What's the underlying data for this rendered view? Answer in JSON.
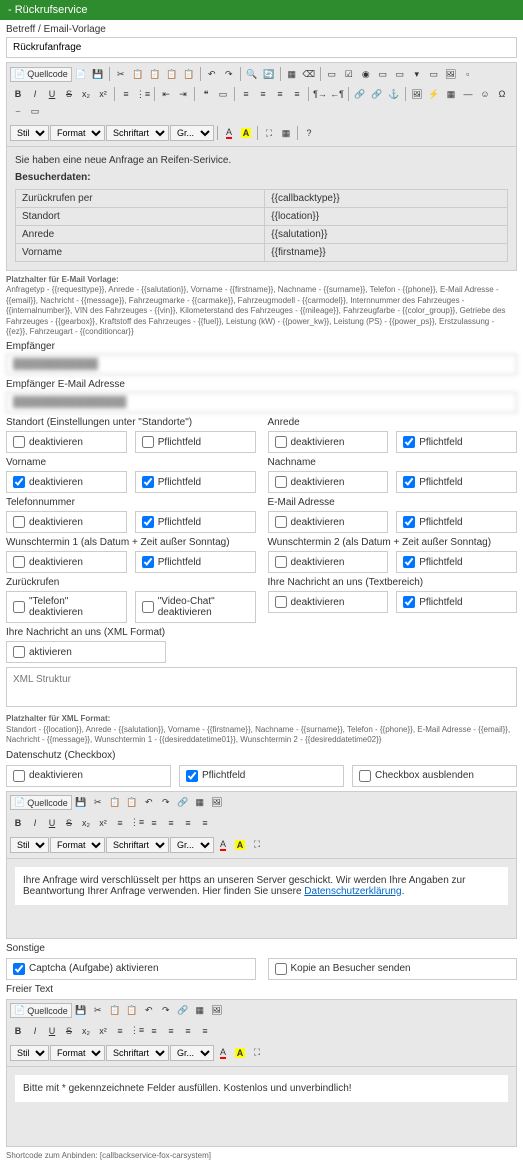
{
  "header": {
    "title": "- Rückrufservice"
  },
  "subject": {
    "label": "Betreff / Email-Vorlage",
    "value": "Rückrufanfrage"
  },
  "toolbar": {
    "quellcode": "Quellcode",
    "stil": "Stil",
    "format": "Format",
    "schriftart": "Schriftart",
    "groesse": "Gr..."
  },
  "editor1": {
    "intro": "Sie haben eine neue Anfrage an Reifen-Serivice.",
    "besucherdaten": "Besucherdaten:",
    "rows": [
      {
        "k": "Zurückrufen per",
        "v": "{{callbacktype}}"
      },
      {
        "k": "Standort",
        "v": "{{location}}"
      },
      {
        "k": "Anrede",
        "v": "{{salutation}}"
      },
      {
        "k": "Vorname",
        "v": "{{firstname}}"
      }
    ]
  },
  "placeholders_email": {
    "title": "Platzhalter für E-Mail Vorlage:",
    "text": "Anfragetyp - {{requesttype}}, Anrede - {{salutation}}, Vorname - {{firstname}}, Nachname - {{surname}}, Telefon - {{phone}}, E-Mail Adresse - {{email}}, Nachricht - {{message}}, Fahrzeugmarke - {{carmake}}, Fahrzeugmodell - {{carmodel}}, Internnummer des Fahrzeuges - {{internalnumber}}, VIN des Fahrzeuges - {{vin}}, Kilometerstand des Fahrzeuges - {{mileage}}, Fahrzeugfarbe - {{color_group}}, Getriebe des Fahrzeuges - {{gearbox}}, Kraftstoff des Fahrzeuges - {{fuel}}, Leistung (kW) - {{power_kw}}, Leistung (PS) - {{power_ps}}, Erstzulassung - {{ez}}, Fahrzeugart - {{conditioncar}}"
  },
  "empfaenger": {
    "label": "Empfänger",
    "value": "████████████"
  },
  "empfaenger_email": {
    "label": "Empfänger E-Mail Adresse",
    "value": "████████████████"
  },
  "labels": {
    "deaktivieren": "deaktivieren",
    "pflichtfeld": "Pflichtfeld",
    "aktivieren": "aktivieren",
    "telefon_deakt": "\"Telefon\" deaktivieren",
    "video_deakt": "\"Video-Chat\" deaktivieren",
    "checkbox_ausblenden": "Checkbox ausblenden",
    "captcha": "Captcha (Aufgabe) aktivieren",
    "kopie": "Kopie an Besucher senden"
  },
  "fields": {
    "standort": "Standort (Einstellungen unter \"Standorte\")",
    "anrede": "Anrede",
    "vorname": "Vorname",
    "nachname": "Nachname",
    "telefon": "Telefonnummer",
    "email": "E-Mail Adresse",
    "wunsch1": "Wunschtermin 1 (als Datum + Zeit außer Sonntag)",
    "wunsch2": "Wunschtermin 2 (als Datum + Zeit außer Sonntag)",
    "zurueckrufen": "Zurückrufen",
    "nachricht_text": "Ihre Nachricht an uns (Textbereich)",
    "nachricht_xml": "Ihre Nachricht an uns (XML Format)",
    "xml_placeholder": "XML Struktur",
    "datenschutz": "Datenschutz (Checkbox)",
    "sonstige": "Sonstige",
    "freier_text": "Freier Text"
  },
  "placeholders_xml": {
    "title": "Platzhalter für XML Format:",
    "text": "Standort - {{location}}, Anrede - {{salutation}}, Vorname - {{firstname}}, Nachname - {{surname}}, Telefon - {{phone}}, E-Mail Adresse - {{email}}, Nachricht - {{message}}, Wunschtermin 1 - {{desireddatetime01}}, Wunschtermin 2 - {{desireddatetime02}}"
  },
  "editor2": {
    "text1": "Ihre Anfrage wird verschlüsselt per https an unseren Server geschickt. Wir werden Ihre Angaben zur Beantwortung Ihrer Anfrage verwenden. Hier finden Sie unsere ",
    "link": "Datenschutzerklärung",
    "text2": "."
  },
  "editor3": {
    "text": "Bitte mit * gekennzeichnete Felder ausfüllen. Kostenlos und unverbindlich!"
  },
  "shortcode": "Shortcode zum Anbinden: [callbackservice-fox-carsystem]"
}
